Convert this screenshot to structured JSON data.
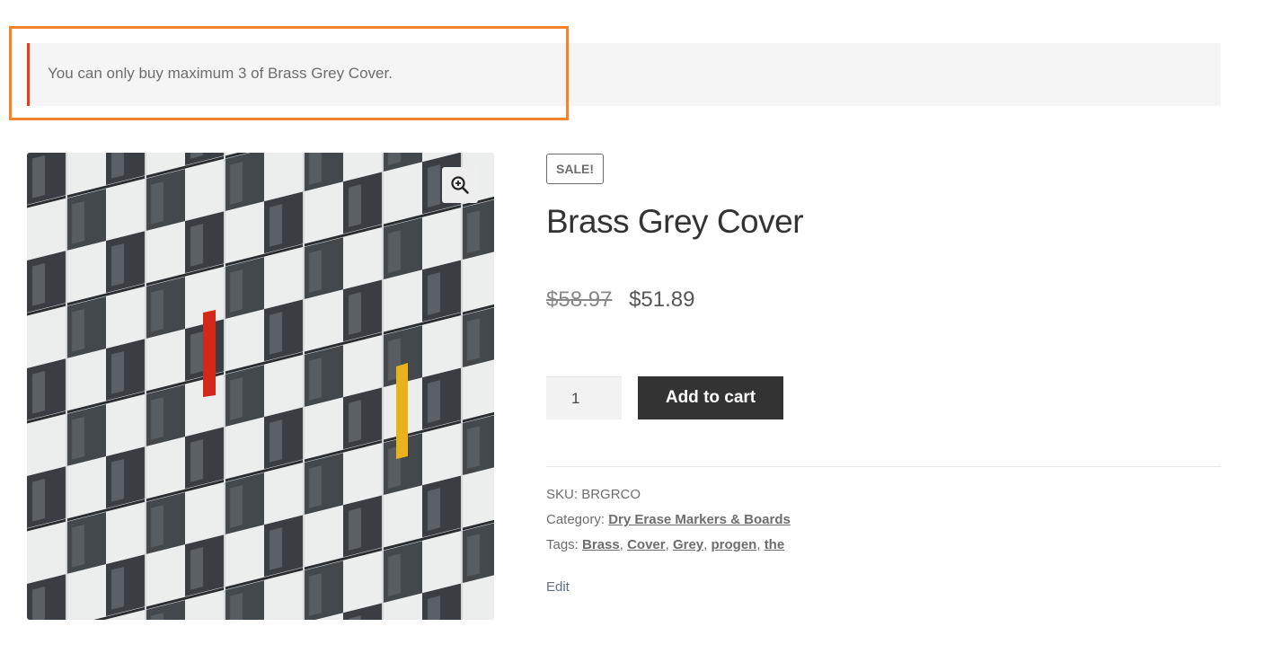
{
  "notice": {
    "message": "You can only buy maximum 3 of Brass Grey Cover.",
    "accent_color": "#e2401c",
    "highlight_color": "#f5832a"
  },
  "product": {
    "badge": "SALE!",
    "title": "Brass Grey Cover",
    "price_regular": "$58.97",
    "price_sale": "$51.89",
    "quantity": "1",
    "add_to_cart_label": "Add to cart",
    "image_alt": "Brass Grey Cover",
    "zoom_icon": "zoom-in-icon"
  },
  "meta": {
    "sku_label": "SKU:",
    "sku_value": "BRGRCO",
    "category_label": "Category:",
    "category": "Dry Erase Markers & Boards",
    "tags_label": "Tags:",
    "tags": [
      "Brass",
      "Cover",
      "Grey",
      "progen",
      "the"
    ],
    "edit_label": "Edit"
  }
}
